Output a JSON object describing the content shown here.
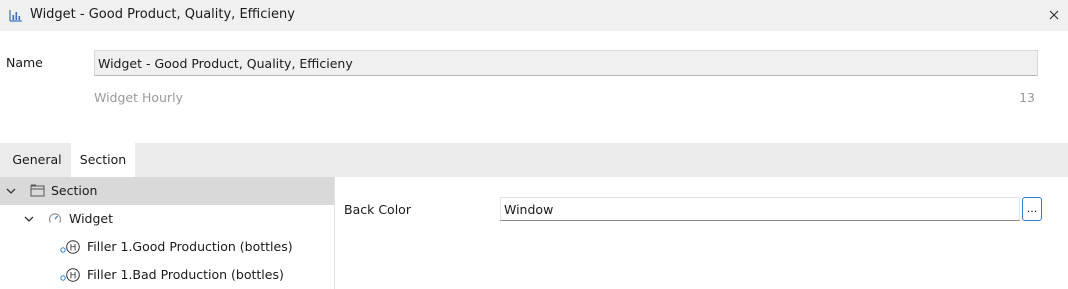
{
  "window": {
    "title": "Widget - Good Product, Quality, Efficieny",
    "icon": "bar-chart-icon",
    "close_icon": "close-icon"
  },
  "form": {
    "name_label": "Name",
    "name_value": "Widget - Good Product, Quality, Efficieny",
    "subtitle": "Widget Hourly",
    "count": "13"
  },
  "tabs": [
    {
      "label": "General",
      "active": false
    },
    {
      "label": "Section",
      "active": true
    }
  ],
  "tree": {
    "items": [
      {
        "label": "Section",
        "icon": "section-folder-icon",
        "expanded": true,
        "selected": true
      },
      {
        "label": "Widget",
        "icon": "gauge-icon",
        "expanded": true,
        "selected": false
      },
      {
        "label": "Filler 1.Good Production (bottles)",
        "icon": "historian-tag-icon",
        "selected": false
      },
      {
        "label": "Filler 1.Bad Production (bottles)",
        "icon": "historian-tag-icon",
        "selected": false
      }
    ]
  },
  "properties": {
    "back_color_label": "Back Color",
    "back_color_value": "Window",
    "browse_label": "..."
  },
  "colors": {
    "titlebar_bg": "#f0f0f0",
    "tabbar_bg": "#ebebeb",
    "selected_row_bg": "#d9d9d9",
    "accent": "#2f7fd0",
    "muted_text": "#9a9a9a"
  }
}
